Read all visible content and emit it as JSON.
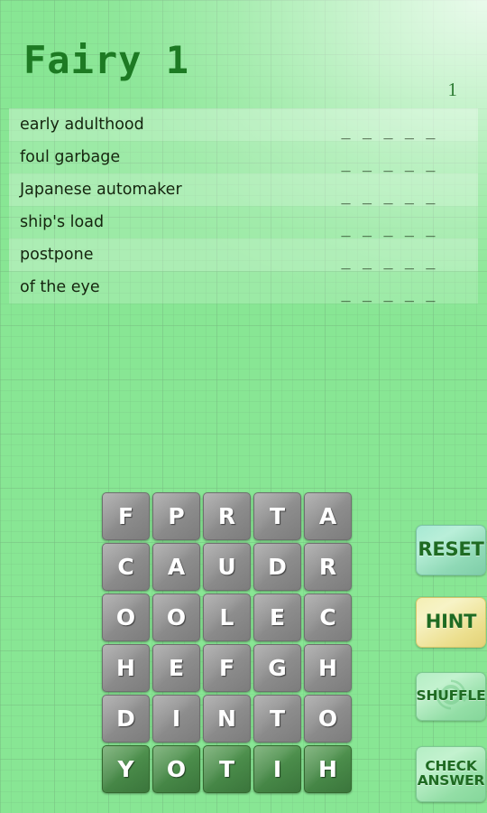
{
  "header": {
    "title": "Fairy 1",
    "level_counter": "1"
  },
  "clues": [
    {
      "text": "early adulthood",
      "blank": "_ _ _ _ _"
    },
    {
      "text": "foul garbage",
      "blank": "_ _ _ _ _"
    },
    {
      "text": "Japanese automaker",
      "blank": "_ _ _ _ _"
    },
    {
      "text": "ship's load",
      "blank": "_ _ _ _ _"
    },
    {
      "text": "postpone",
      "blank": "_ _ _ _ _"
    },
    {
      "text": "of the eye",
      "blank": "_ _ _ _ _"
    }
  ],
  "letter_grid": {
    "rows": 6,
    "cols": 5,
    "tiles": [
      {
        "letter": "F",
        "state": "available"
      },
      {
        "letter": "P",
        "state": "available"
      },
      {
        "letter": "R",
        "state": "available"
      },
      {
        "letter": "T",
        "state": "available"
      },
      {
        "letter": "A",
        "state": "available"
      },
      {
        "letter": "C",
        "state": "available"
      },
      {
        "letter": "A",
        "state": "available"
      },
      {
        "letter": "U",
        "state": "available"
      },
      {
        "letter": "D",
        "state": "available"
      },
      {
        "letter": "R",
        "state": "available"
      },
      {
        "letter": "O",
        "state": "available"
      },
      {
        "letter": "O",
        "state": "available"
      },
      {
        "letter": "L",
        "state": "available"
      },
      {
        "letter": "E",
        "state": "available"
      },
      {
        "letter": "C",
        "state": "available"
      },
      {
        "letter": "H",
        "state": "available"
      },
      {
        "letter": "E",
        "state": "available"
      },
      {
        "letter": "F",
        "state": "available"
      },
      {
        "letter": "G",
        "state": "available"
      },
      {
        "letter": "H",
        "state": "available"
      },
      {
        "letter": "D",
        "state": "available"
      },
      {
        "letter": "I",
        "state": "available"
      },
      {
        "letter": "N",
        "state": "available"
      },
      {
        "letter": "T",
        "state": "available"
      },
      {
        "letter": "O",
        "state": "available"
      },
      {
        "letter": "Y",
        "state": "selected"
      },
      {
        "letter": "O",
        "state": "selected"
      },
      {
        "letter": "T",
        "state": "selected"
      },
      {
        "letter": "I",
        "state": "selected"
      },
      {
        "letter": "H",
        "state": "selected"
      }
    ]
  },
  "buttons": {
    "reset": "RESET",
    "hint": "HINT",
    "shuffle": "SHUFFLE",
    "check_line1": "CHECK",
    "check_line2": "ANSWER"
  },
  "colors": {
    "background_green": "#88e694",
    "title_green": "#1d7a23",
    "tile_gray": "#8d8d8d",
    "tile_green": "#4a8c4a",
    "button_text": "#1f6b22",
    "reset_mint": "#8fd9b6",
    "hint_gold": "#ecdf8e",
    "shuffle_green": "#93dea6"
  }
}
